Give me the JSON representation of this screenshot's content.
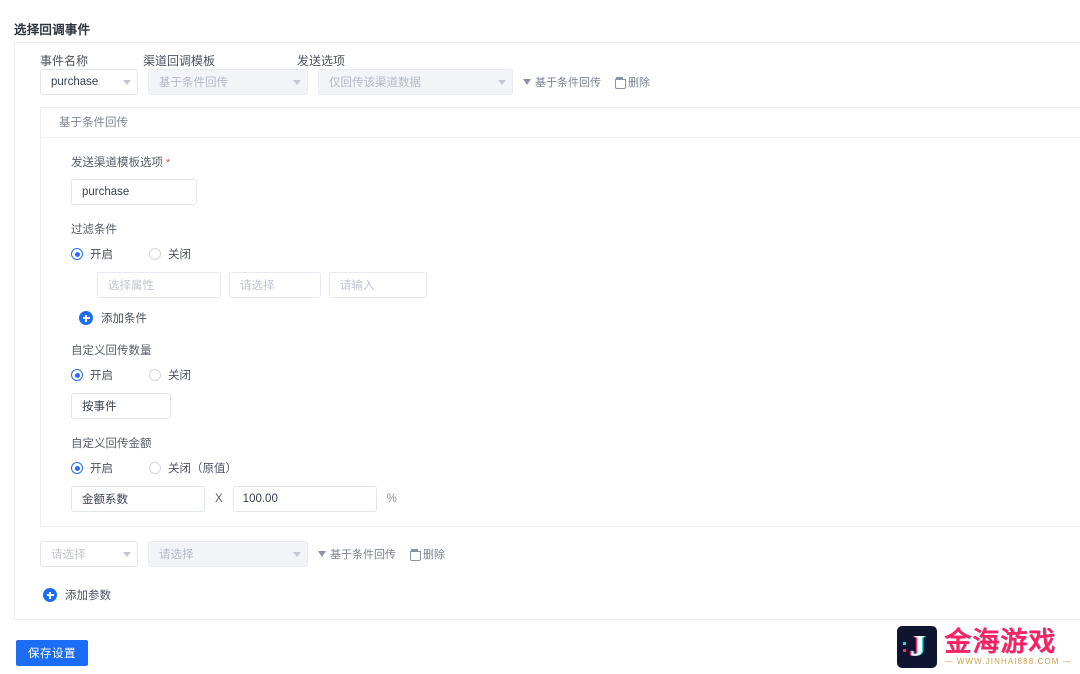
{
  "page": {
    "title": "选择回调事件"
  },
  "columns": {
    "event_name": "事件名称",
    "channel_template": "渠道回调模板",
    "send_option": "发送选项"
  },
  "event_row": {
    "event_name_value": "purchase",
    "channel_template_value": "基于条件回传",
    "send_option_value": "仅回传该渠道数据",
    "actions": {
      "filter_label": "基于条件回传",
      "delete_label": "删除",
      "filter_icon": "funnel-icon",
      "delete_icon": "trash-icon"
    }
  },
  "panel": {
    "header": "基于条件回传",
    "template_option": {
      "label": "发送渠道模板选项",
      "required_mark": "*",
      "value": "purchase"
    },
    "filter_condition": {
      "label": "过滤条件",
      "radio_on": "开启",
      "radio_off": "关闭",
      "selected": "开启",
      "condition_row": {
        "attribute_placeholder": "选择属性",
        "operator_placeholder": "请选择",
        "value_placeholder": "请输入"
      },
      "add_condition_label": "添加条件",
      "add_condition_icon": "plus-circle-icon"
    },
    "custom_count": {
      "label": "自定义回传数量",
      "radio_on": "开启",
      "radio_off": "关闭",
      "selected": "开启",
      "mode_value": "按事件"
    },
    "custom_amount": {
      "label": "自定义回传金额",
      "radio_on": "开启",
      "radio_off": "关闭（原值）",
      "selected": "开启",
      "coefficient_value": "金额系数",
      "multiply_symbol": "X",
      "amount_value": "100.00",
      "percent_symbol": "%"
    }
  },
  "param_row": {
    "select_a_placeholder": "请选择",
    "select_b_placeholder": "请选择",
    "actions": {
      "filter_label": "基于条件回传",
      "delete_label": "删除"
    }
  },
  "add_param": {
    "label": "添加参数",
    "icon": "plus-circle-icon"
  },
  "footer": {
    "save_label": "保存设置"
  },
  "watermark": {
    "badge_letter": "J",
    "brand": "金海游戏",
    "url": "— WWW.JINHAI888.COM —"
  },
  "colors": {
    "accent": "#1b6ef3",
    "radio_checked": "#2a6df4",
    "required": "#f04a4a",
    "watermark_pink": "#ff1f63"
  }
}
